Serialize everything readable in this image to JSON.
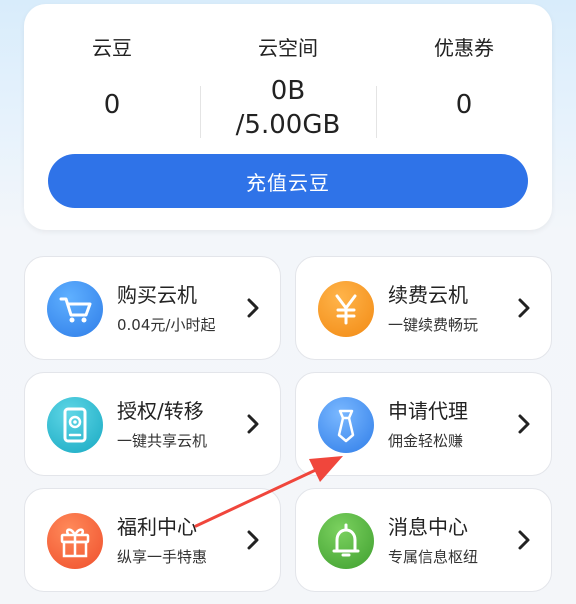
{
  "account": {
    "stats": [
      {
        "label": "云豆",
        "value": "0"
      },
      {
        "label": "云空间",
        "value": "0B\n/5.00GB"
      },
      {
        "label": "优惠券",
        "value": "0"
      }
    ],
    "recharge_label": "充值云豆"
  },
  "tiles": [
    {
      "title": "购买云机",
      "subtitle": "0.04元/小时起",
      "icon": "cart-icon",
      "color": "#2f8cf0"
    },
    {
      "title": "续费云机",
      "subtitle": "一键续费畅玩",
      "icon": "yen-icon",
      "color": "#f7941d"
    },
    {
      "title": "授权/转移",
      "subtitle": "一键共享云机",
      "icon": "phone-share-icon",
      "color": "#1fb5c9"
    },
    {
      "title": "申请代理",
      "subtitle": "佣金轻松赚",
      "icon": "tie-icon",
      "color": "#3a8ff0"
    },
    {
      "title": "福利中心",
      "subtitle": "纵享一手特惠",
      "icon": "gift-icon",
      "color": "#f4603a"
    },
    {
      "title": "消息中心",
      "subtitle": "专属信息枢纽",
      "icon": "bell-icon",
      "color": "#4caf3a"
    }
  ],
  "colors": {
    "accent": "#2f73e8",
    "annotation_arrow": "#f0463c"
  }
}
